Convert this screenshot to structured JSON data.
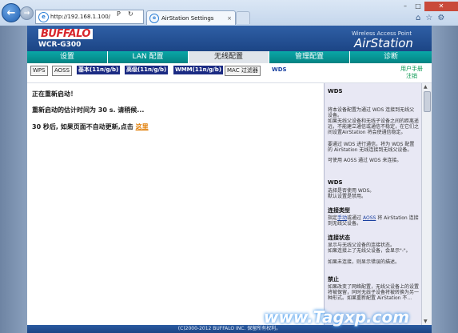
{
  "browser": {
    "url": "http://192.168.1.100/",
    "search_btn": "P",
    "refresh_btn": "↻",
    "tab_title": "AirStation Settings",
    "tab_close": "×"
  },
  "header": {
    "logo": "BUFFALO",
    "model": "WCR-G300",
    "wireless_label": "Wireless Access Point",
    "brand": "AirStation"
  },
  "nav": [
    {
      "label": "设置",
      "active": false
    },
    {
      "label": "LAN 配置",
      "active": false
    },
    {
      "label": "无线配置",
      "active": true
    },
    {
      "label": "管理配置",
      "active": false
    },
    {
      "label": "诊断",
      "active": false
    }
  ],
  "subnav": [
    {
      "label": "WPS",
      "style": "plain"
    },
    {
      "label": "AOSS",
      "style": "plain"
    },
    {
      "label": "基本(11n/g/b)",
      "style": "blue"
    },
    {
      "label": "高级(11n/g/b)",
      "style": "blue"
    },
    {
      "label": "WMM(11n/g/b)",
      "style": "blue"
    },
    {
      "label": "MAC 过滤器",
      "style": "plain"
    },
    {
      "label": "WDS",
      "style": "link"
    }
  ],
  "help_links": {
    "manual": "用户手册",
    "logout": "注销"
  },
  "main": {
    "line1": "正在重新启动！",
    "line2": "重新启动的估计时间为  30 s. 请稍候...",
    "line3_prefix": "30 秒后, 如果页面不自动更新,点击",
    "line3_link": "这里"
  },
  "side": {
    "wds_title1": "WDS",
    "wds_p1": "将本设备配置为通过 WDS 连接到无线父设备。",
    "wds_p2": "如果无线父设备和无线子设备之间的距离遥远，不能建立通信或通信不稳定，在它们之间设置AirStation 将会使通信稳定。",
    "wds_p3": "要通过 WDS 进行通信，将为 WDS 配置的 AirStation 无线连接到无线父设备。",
    "wds_p4": "可使用 AOSS 通过 WDS 来连接。",
    "wds_title2": "WDS",
    "wds_p5": "选择是否使用 WDS。",
    "wds_p6": "默认设置是禁用。",
    "conn_type_title": "连接类型",
    "conn_type_p_prefix": "指定",
    "conn_type_link1": "手动",
    "conn_type_mid": "或通过",
    "conn_type_link2": "AOSS",
    "conn_type_suffix": "将 AirStation 连接到无线父设备。",
    "conn_status_title": "连接状态",
    "conn_status_p1": "显示与无线父设备的连接状态。",
    "conn_status_p2": "如果连接上了无线父设备，会显示\"-\"。",
    "conn_status_p3": "如果未连接，则显示错误的描述。",
    "disable_title": "禁止",
    "disable_p": "如果改变了网络配置，无线父设备上的设置将被保留，同时无线子设备将被转换为另一种形式。如果重新配置 AirStation 不..."
  },
  "footer": "(C)2000-2012 BUFFALO INC. 保留所有权利。",
  "watermark": "www.Tagxp.com",
  "colors": {
    "accent": "#048383",
    "header": "#1c4585",
    "link": "#e07b00"
  }
}
